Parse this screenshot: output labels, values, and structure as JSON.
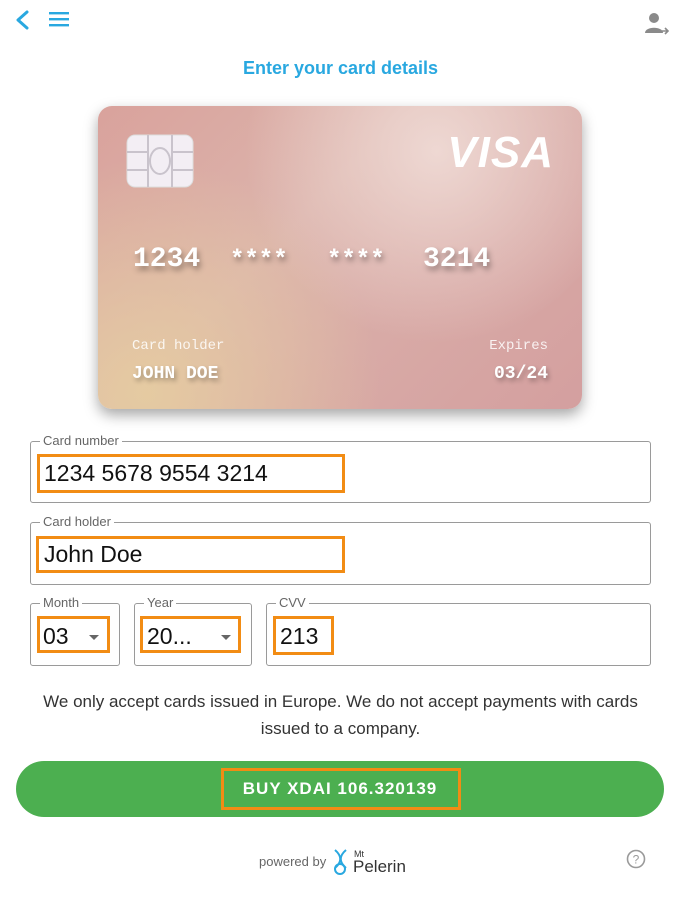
{
  "page": {
    "title": "Enter your card details"
  },
  "card_preview": {
    "brand": "VISA",
    "number_segments": [
      "1234",
      "****",
      "****",
      "3214"
    ],
    "holder_label": "Card holder",
    "holder_value": "JOHN DOE",
    "expires_label": "Expires",
    "expires_value": "03/24"
  },
  "form": {
    "card_number": {
      "label": "Card number",
      "value": "1234 5678 9554 3214"
    },
    "card_holder": {
      "label": "Card holder",
      "value": "John Doe"
    },
    "month": {
      "label": "Month",
      "value": "03"
    },
    "year": {
      "label": "Year",
      "value": "20..."
    },
    "cvv": {
      "label": "CVV",
      "value": "213"
    }
  },
  "notice": "We only accept cards issued in Europe. We do not accept payments with cards issued to a company.",
  "buy_button": {
    "label": "BUY XDAI 106.320139"
  },
  "footer": {
    "powered_by": "powered by",
    "brand_mt": "Mt",
    "brand_name": "Pelerin"
  },
  "icons": {
    "back": "chevron-left-icon",
    "menu": "hamburger-menu-icon",
    "user": "user-login-icon",
    "help": "question-circle-icon"
  },
  "colors": {
    "accent": "#29a8e0",
    "button": "#4caf50",
    "highlight": "#f28c14"
  }
}
